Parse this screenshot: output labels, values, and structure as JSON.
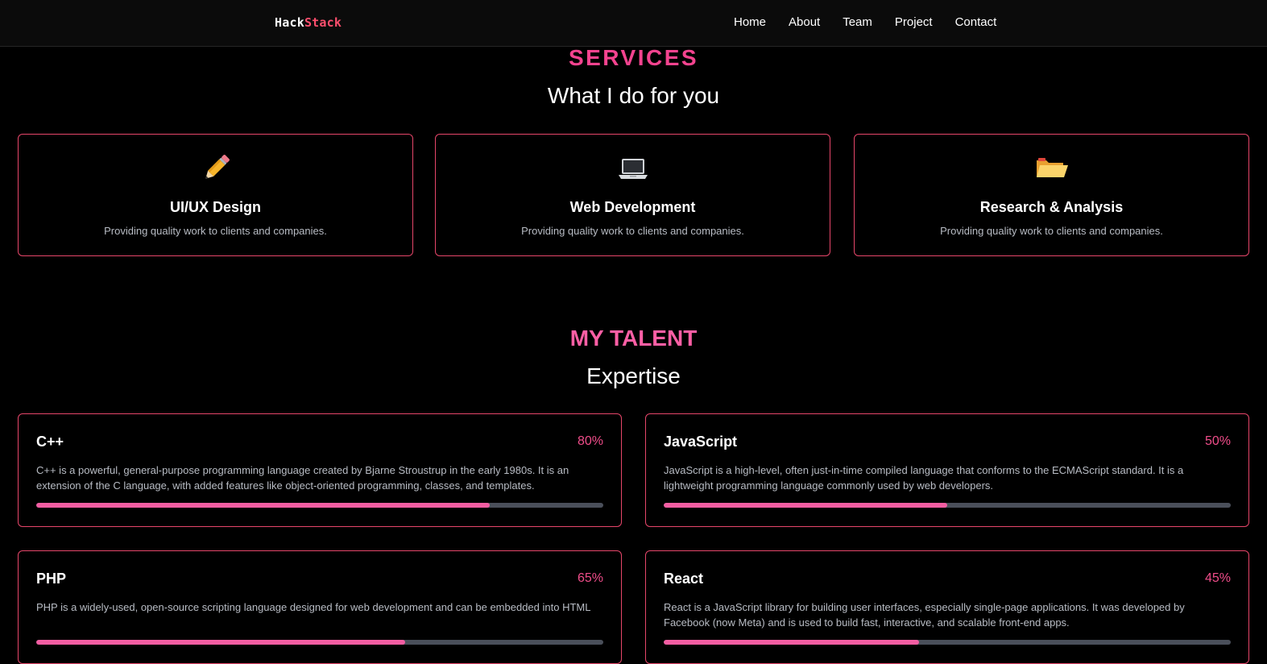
{
  "nav": {
    "logo_part1": "Hack",
    "logo_part2": "Stack",
    "links": [
      "Home",
      "About",
      "Team",
      "Project",
      "Contact"
    ]
  },
  "services": {
    "label": "SERVICES",
    "subtitle": "What I do for you",
    "cards": [
      {
        "icon": "pencil-icon",
        "title": "UI/UX Design",
        "desc": "Providing quality work to clients and companies."
      },
      {
        "icon": "laptop-icon",
        "title": "Web Development",
        "desc": "Providing quality work to clients and companies."
      },
      {
        "icon": "folder-icon",
        "title": "Research & Analysis",
        "desc": "Providing quality work to clients and companies."
      }
    ]
  },
  "talent": {
    "label": "MY TALENT",
    "subtitle": "Expertise",
    "skills": [
      {
        "name": "C++",
        "percent_label": "80%",
        "level": 0.8,
        "desc": "C++ is a powerful, general-purpose programming language created by Bjarne Stroustrup in the early 1980s. It is an extension of the C language, with added features like object-oriented programming, classes, and templates."
      },
      {
        "name": "JavaScript",
        "percent_label": "50%",
        "level": 0.5,
        "desc": "JavaScript is a high-level, often just-in-time compiled language that conforms to the ECMAScript standard. It is a lightweight programming language commonly used by web developers."
      },
      {
        "name": "PHP",
        "percent_label": "65%",
        "level": 0.65,
        "desc": "PHP is a widely-used, open-source scripting language designed for web development and can be embedded into HTML"
      },
      {
        "name": "React",
        "percent_label": "45%",
        "level": 0.45,
        "desc": "React is a JavaScript library for building user interfaces, especially single-page applications. It was developed by Facebook (now Meta) and is used to build fast, interactive, and scalable front-end apps."
      }
    ]
  },
  "colors": {
    "accent": "#f4438f",
    "card_border": "#e6466a",
    "bar_fill": "#f35da2",
    "bar_track": "#4a4f5a"
  }
}
